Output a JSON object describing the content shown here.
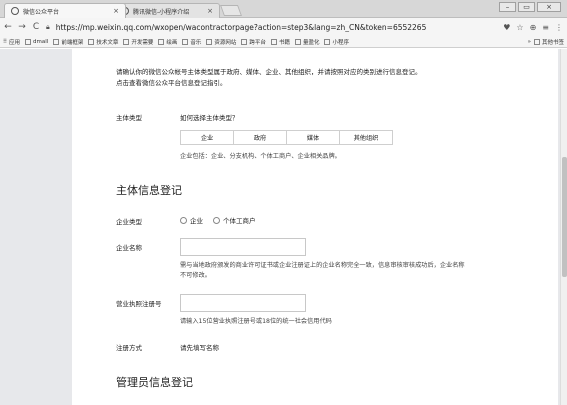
{
  "browser": {
    "tabs": [
      {
        "title": "微信公众平台",
        "close": "×"
      },
      {
        "title": "腾讯微信-小程序介绍",
        "close": "×"
      }
    ],
    "window_buttons": [
      "–",
      "▭",
      "×"
    ],
    "nav": {
      "back": "←",
      "forward": "→",
      "reload": "C"
    },
    "url": "https://mp.weixin.qq.com/wxopen/wacontractorpage?action=step3&lang=zh_CN&token=6552265",
    "addr_icons": [
      "♥",
      "☆",
      "⊕",
      "≡",
      "⋮"
    ],
    "bookmarks": [
      "应用",
      "dmall",
      "前端框架",
      "技术文章",
      "开发需要",
      "绘画",
      "音乐",
      "资源网站",
      "跨平台",
      "书籍",
      "量盈化",
      "小程序"
    ],
    "bookmarks_more": "»",
    "bookmarks_other": "其他书签"
  },
  "page": {
    "notice_line1": "请确认你的微信公众帐号主体类型属于政府、媒体、企业、其他组织，并请按照对应的类别进行信息登记。",
    "notice_line2": "点击查看微信公众平台信息登记指引。",
    "entity_type": {
      "label": "主体类型",
      "link": "如何选择主体类型？",
      "options": [
        "企业",
        "政府",
        "媒体",
        "其他组织"
      ],
      "note": "企业包括：企业、分支机构、个体工商户、企业相关品牌。"
    },
    "entity_info_title": "主体信息登记",
    "company_type": {
      "label": "企业类型",
      "options": [
        "企业",
        "个体工商户"
      ]
    },
    "company_name": {
      "label": "企业名称",
      "value": "",
      "hint_line1": "需与当地政府颁发的商业许可证书或企业注册证上的企业名称完全一致，信息审核审核成功后，企业名称",
      "hint_line2": "不可修改。"
    },
    "license_number": {
      "label": "营业执照注册号",
      "value": "",
      "hint": "请输入15位营业执照注册号或18位的统一社会信用代码"
    },
    "registration_method": {
      "label": "注册方式",
      "value": "请先填写名称"
    },
    "admin_info_title": "管理员信息登记"
  }
}
